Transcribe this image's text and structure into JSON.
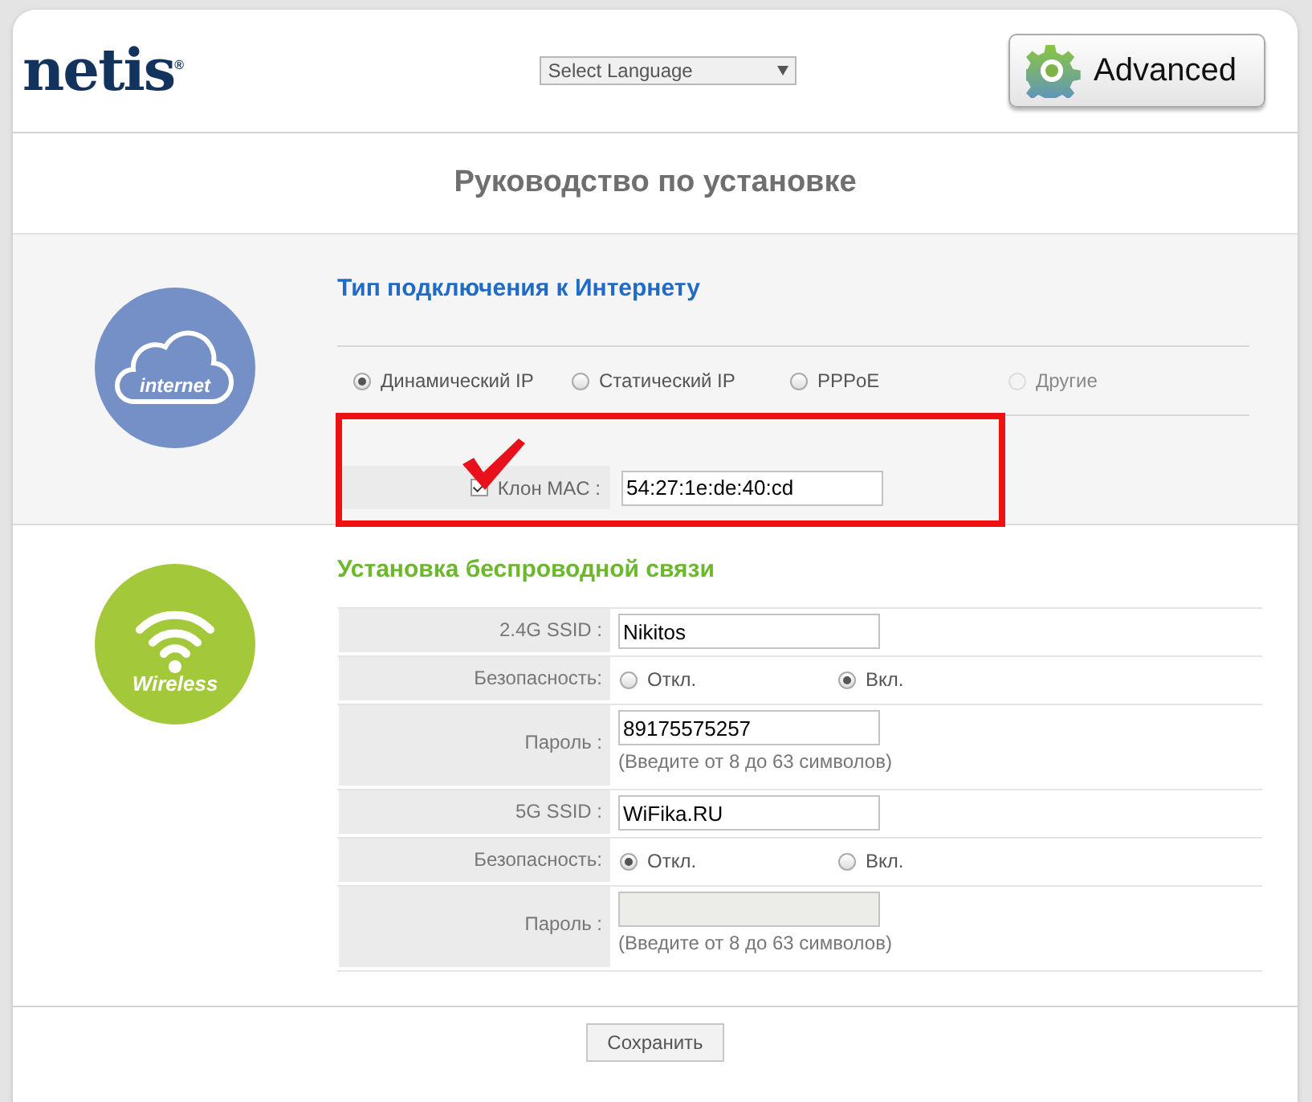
{
  "header": {
    "logo": "netis$^{®}$",
    "language_select": {
      "value": "Select Language"
    },
    "advanced_button": "Advanced"
  },
  "page_title": "Руководство по установке",
  "internet": {
    "icon_label": "internet",
    "heading": "Тип подключения к Интернету",
    "connection_types": [
      {
        "label": "Динамический IP",
        "selected": true,
        "disabled": false
      },
      {
        "label": "Статический IP",
        "selected": false,
        "disabled": false
      },
      {
        "label": "PPPoE",
        "selected": false,
        "disabled": false
      },
      {
        "label": "Другие",
        "selected": false,
        "disabled": true
      }
    ],
    "mac_clone": {
      "label": "Клон MAC :",
      "checked": true,
      "value": "54:27:1e:de:40:cd"
    }
  },
  "wireless": {
    "icon_label": "Wireless",
    "heading": "Установка беспроводной связи",
    "rows": [
      {
        "kind": "text",
        "label": "2.4G SSID :",
        "value": "Nikitos"
      },
      {
        "kind": "radio",
        "label": "Безопасность:",
        "options": [
          {
            "label": "Откл.",
            "selected": false
          },
          {
            "label": "Вкл.",
            "selected": true
          }
        ]
      },
      {
        "kind": "password",
        "label": "Пароль :",
        "value": "89175575257",
        "hint": "(Введите от 8 до 63 символов)",
        "disabled": false
      },
      {
        "kind": "text",
        "label": "5G SSID :",
        "value": "WiFika.RU"
      },
      {
        "kind": "radio",
        "label": "Безопасность:",
        "options": [
          {
            "label": "Откл.",
            "selected": true
          },
          {
            "label": "Вкл.",
            "selected": false
          }
        ]
      },
      {
        "kind": "password",
        "label": "Пароль :",
        "hint": "(Введите от 8 до 63 символов)",
        "disabled": true
      }
    ]
  },
  "save_button": "Сохранить"
}
